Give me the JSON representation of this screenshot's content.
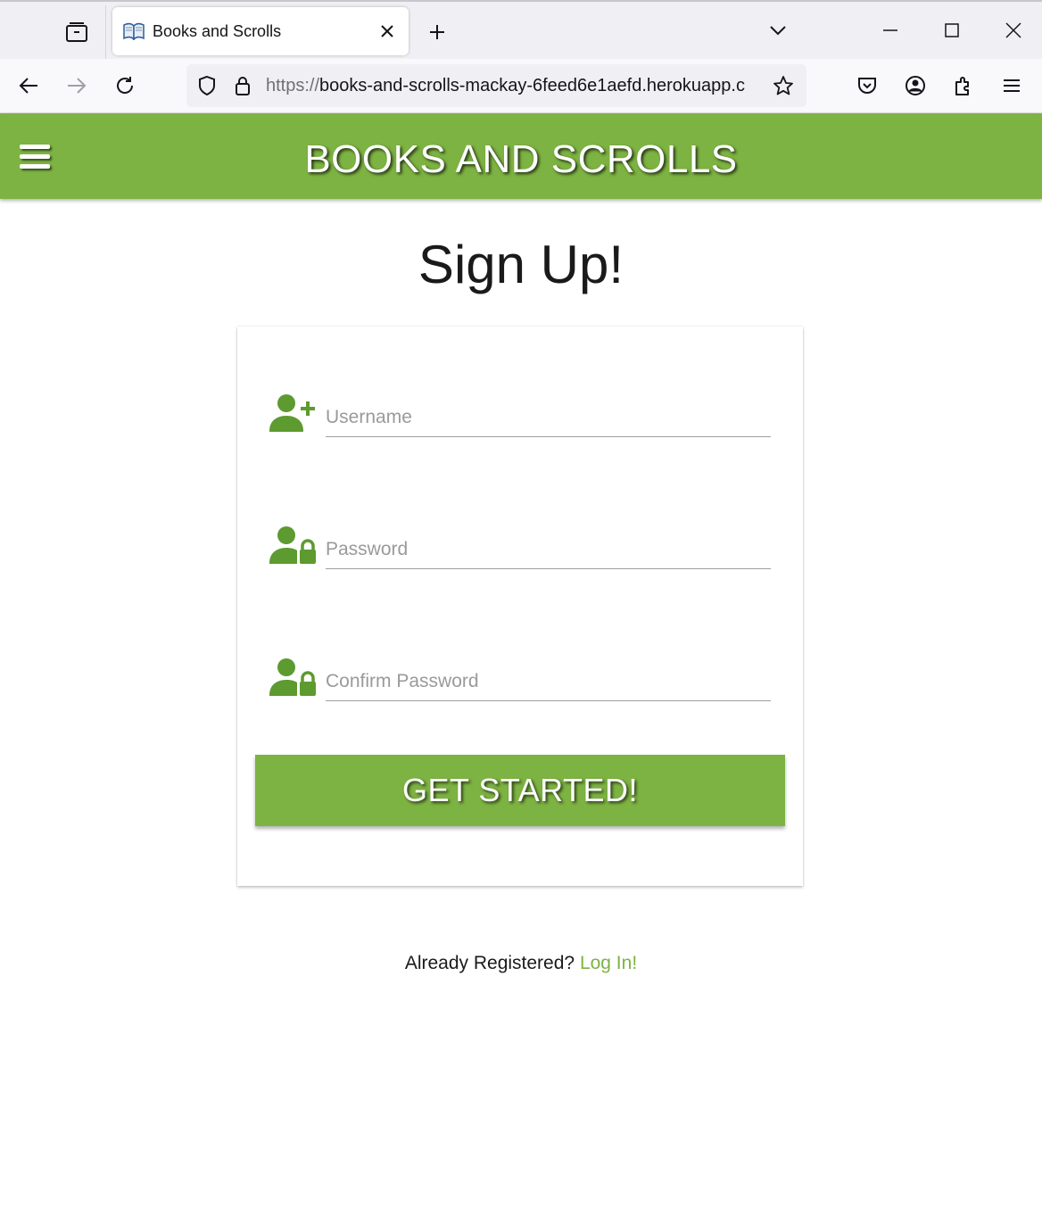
{
  "browser": {
    "tab_title": "Books and Scrolls",
    "url_scheme": "https://",
    "url_rest": "books-and-scrolls-mackay-6feed6e1aefd.herokuapp.c"
  },
  "header": {
    "brand": "BOOKS AND SCROLLS"
  },
  "main": {
    "title": "Sign Up!",
    "fields": {
      "username_placeholder": "Username",
      "password_placeholder": "Password",
      "confirm_placeholder": "Confirm Password"
    },
    "submit_label": "GET STARTED!",
    "login_prompt": "Already Registered?",
    "login_link": "Log In!"
  },
  "colors": {
    "brand_green": "#7db342",
    "icon_green": "#5d9a2f"
  }
}
